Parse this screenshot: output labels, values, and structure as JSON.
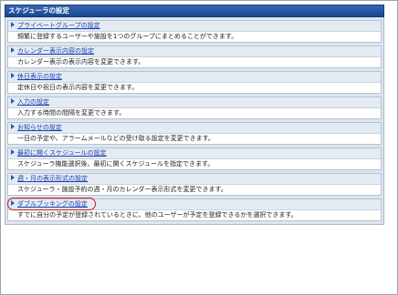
{
  "panel": {
    "title": "スケジューラの設定"
  },
  "items": [
    {
      "label": "プライベートグループの設定",
      "description": "頻繁に登録するユーザーや施設を1つのグループにまとめることができます。"
    },
    {
      "label": "カレンダー表示内容の設定",
      "description": "カレンダー表示の表示内容を変更できます。"
    },
    {
      "label": "休日表示の設定",
      "description": "定休日や祝日の表示内容を変更できます。"
    },
    {
      "label": "入力の設定",
      "description": "入力する時間の間隔を変更できます。"
    },
    {
      "label": "お知らせの設定",
      "description": "一日の予定や、アラームメールなどの受け取る設定を変更できます。"
    },
    {
      "label": "最初に開くスケジュールの設定",
      "description": "スケジューラ機能選択後、最初に開くスケジュールを指定できます。"
    },
    {
      "label": "週・月の表示形式の設定",
      "description": "スケジューラ・施設予約の週・月のカレンダー表示形式を変更できます。"
    },
    {
      "label": "ダブルブッキングの設定",
      "description": "すでに自分の予定が登録されているときに、他のユーザーが予定を登録できるかを選択できます。"
    }
  ],
  "colors": {
    "header": "#1d4fa0",
    "link": "#1a3fb0",
    "highlight": "#d11a1a"
  },
  "icons": {
    "item_marker": "triangle-right-icon"
  }
}
